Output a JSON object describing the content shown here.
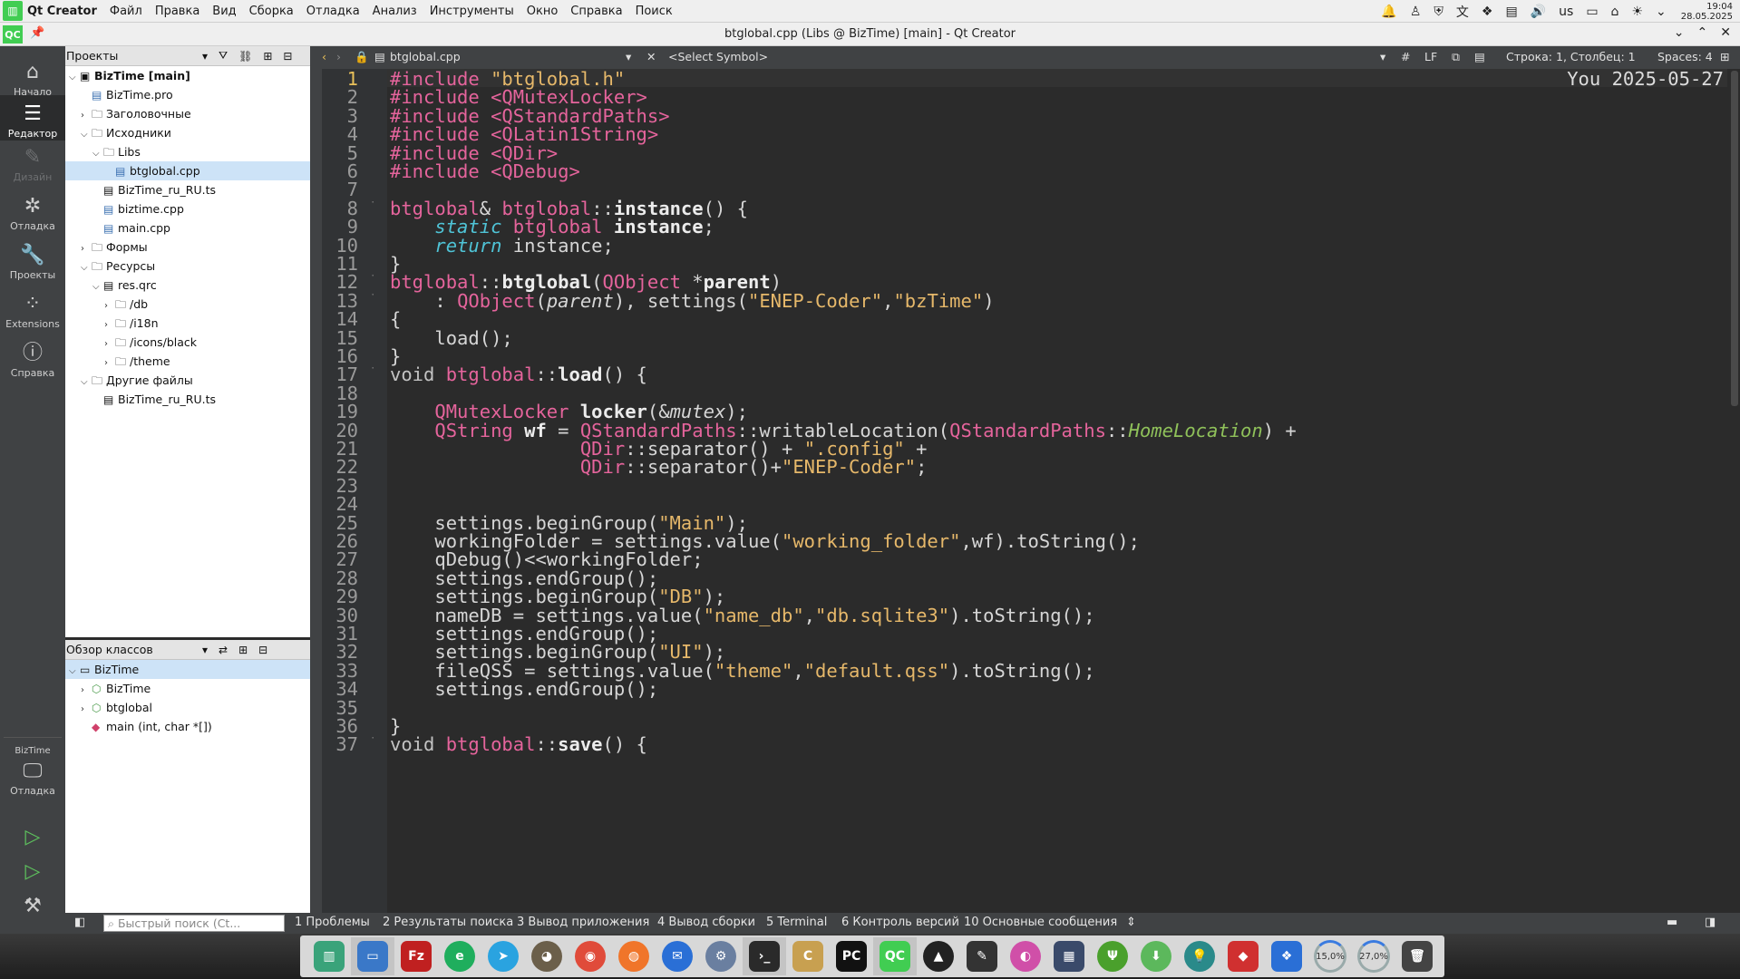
{
  "menubar": {
    "app_name": "Qt Creator",
    "items": [
      "Файл",
      "Правка",
      "Вид",
      "Сборка",
      "Отладка",
      "Анализ",
      "Инструменты",
      "Окно",
      "Справка",
      "Поиск"
    ],
    "tray_lang": "us",
    "clock_time": "19:04",
    "clock_date": "28.05.2025"
  },
  "titlebar": {
    "badge": "QC",
    "title": "btglobal.cpp (Libs @ BizTime) [main] - Qt Creator"
  },
  "modes": {
    "start": "Начало",
    "editor": "Редактор",
    "design": "Дизайн",
    "debug": "Отладка",
    "projects": "Проекты",
    "extensions": "Extensions",
    "help": "Справка",
    "target_project": "BizTime",
    "target_config": "Отладка"
  },
  "projects_panel": {
    "title": "Проекты",
    "items": [
      {
        "label": "BizTime [main]",
        "level": 0,
        "twisty": "v",
        "icon": "project-icon",
        "bold": true
      },
      {
        "label": "BizTime.pro",
        "level": 1,
        "twisty": "",
        "icon": "pro-file-icon"
      },
      {
        "label": "Заголовочные",
        "level": 1,
        "twisty": ">",
        "icon": "folder-icon"
      },
      {
        "label": "Исходники",
        "level": 1,
        "twisty": "v",
        "icon": "folder-icon"
      },
      {
        "label": "Libs",
        "level": 2,
        "twisty": "v",
        "icon": "folder-icon"
      },
      {
        "label": "btglobal.cpp",
        "level": 3,
        "twisty": "",
        "icon": "cpp-file-icon",
        "selected": true
      },
      {
        "label": "BizTime_ru_RU.ts",
        "level": 2,
        "twisty": "",
        "icon": "file-icon"
      },
      {
        "label": "biztime.cpp",
        "level": 2,
        "twisty": "",
        "icon": "cpp-file-icon"
      },
      {
        "label": "main.cpp",
        "level": 2,
        "twisty": "",
        "icon": "cpp-file-icon"
      },
      {
        "label": "Формы",
        "level": 1,
        "twisty": ">",
        "icon": "folder-icon"
      },
      {
        "label": "Ресурсы",
        "level": 1,
        "twisty": "v",
        "icon": "folder-icon"
      },
      {
        "label": "res.qrc",
        "level": 2,
        "twisty": "v",
        "icon": "qrc-file-icon"
      },
      {
        "label": "/db",
        "level": 3,
        "twisty": ">",
        "icon": "folder-icon"
      },
      {
        "label": "/i18n",
        "level": 3,
        "twisty": ">",
        "icon": "folder-icon"
      },
      {
        "label": "/icons/black",
        "level": 3,
        "twisty": ">",
        "icon": "folder-icon"
      },
      {
        "label": "/theme",
        "level": 3,
        "twisty": ">",
        "icon": "folder-icon"
      },
      {
        "label": "Другие файлы",
        "level": 1,
        "twisty": "v",
        "icon": "folder-icon"
      },
      {
        "label": "BizTime_ru_RU.ts",
        "level": 2,
        "twisty": "",
        "icon": "file-icon"
      }
    ]
  },
  "class_panel": {
    "title": "Обзор классов",
    "items": [
      {
        "label": "BizTime",
        "level": 0,
        "twisty": "v",
        "icon": "namespace-icon",
        "selected": true
      },
      {
        "label": "BizTime",
        "level": 1,
        "twisty": ">",
        "icon": "class-icon"
      },
      {
        "label": "btglobal",
        "level": 1,
        "twisty": ">",
        "icon": "class-icon"
      },
      {
        "label": "main (int, char *[])",
        "level": 1,
        "twisty": "",
        "icon": "function-icon"
      }
    ]
  },
  "editor_bar": {
    "file": "btglobal.cpp",
    "symbol": "<Select Symbol>",
    "hash": "#",
    "line_ending": "LF",
    "position": "Строка: 1, Столбец: 1",
    "spaces": "Spaces: 4"
  },
  "editor": {
    "blame": "You 2025-05-27",
    "current_line": 1
  },
  "outbar": {
    "search_placeholder": "Быстрый поиск (Ct...",
    "tabs": [
      "1  Проблемы",
      "2  Результаты поиска",
      "3  Вывод приложения",
      "4  Вывод сборки",
      "5  Terminal",
      "6  Контроль версий",
      "10  Основные сообщения"
    ]
  },
  "taskbar": {
    "cpu": "15,0%",
    "mem": "27,0%"
  },
  "colors": {
    "preprocessor": "#e5649c",
    "string": "#e6b86a",
    "keyword_italic": "#4fc3d6",
    "enum": "#8fc15a",
    "qt_green": "#41cd52"
  }
}
